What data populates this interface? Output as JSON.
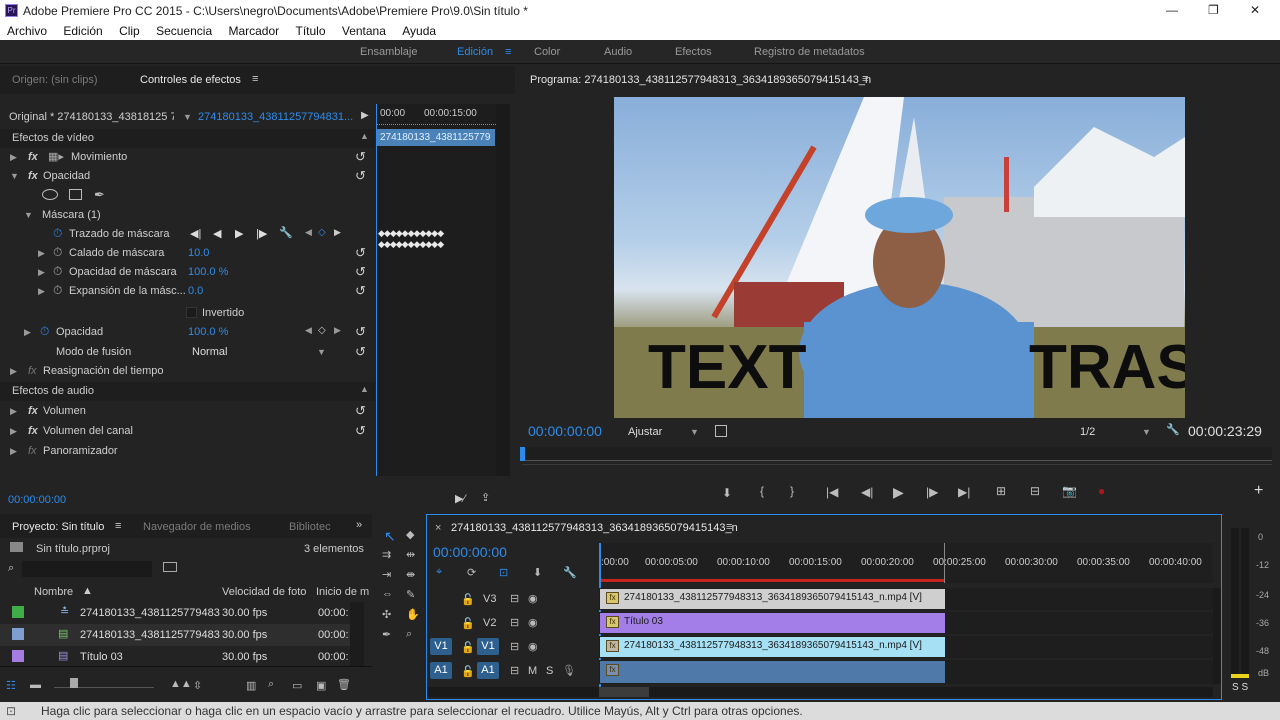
{
  "app": {
    "title": "Adobe Premiere Pro CC 2015 - C:\\Users\\negro\\Documents\\Adobe\\Premiere Pro\\9.0\\Sin título *",
    "window_controls": [
      "—",
      "❐",
      "✕"
    ]
  },
  "menu": [
    "Archivo",
    "Edición",
    "Clip",
    "Secuencia",
    "Marcador",
    "Título",
    "Ventana",
    "Ayuda"
  ],
  "workspaces": [
    "Ensamblaje",
    "Edición",
    "Color",
    "Audio",
    "Efectos",
    "Registro de metadatos"
  ],
  "source_panel": {
    "tab_origin": "Origen: (sin clips)",
    "tab_effects": "Controles de efectos",
    "master_label": "Original * 274180133_43818125 7...",
    "clip_label": "274180133_43811257794831...",
    "ruler_start": "00:00",
    "ruler_mark": "00:00:15:00",
    "mini_clip": "274180133_4381125779",
    "video_effects": "Efectos de vídeo",
    "rows": {
      "movimiento": "Movimiento",
      "opacidad": "Opacidad",
      "mascara": "Máscara (1)",
      "trazado": "Trazado de máscara",
      "calado": "Calado de máscara",
      "calado_val": "10.0",
      "op_mascara": "Opacidad de máscara",
      "op_mascara_val": "100.0 %",
      "expansion": "Expansión de la másc...",
      "expansion_val": "0.0",
      "invertido": "Invertido",
      "opacidad2": "Opacidad",
      "opacidad2_val": "100.0 %",
      "fusion": "Modo de fusión",
      "fusion_val": "Normal",
      "reasign": "Reasignación del tiempo"
    },
    "audio_effects": "Efectos de audio",
    "audio_rows": [
      "Volumen",
      "Volumen del canal",
      "Panoramizador"
    ],
    "timecode": "00:00:00:00"
  },
  "program": {
    "title": "Programa: 274180133_438112577948313_3634189365079415143_n",
    "timecode_in": "00:00:00:00",
    "fit": "Ajustar",
    "resolution": "1/2",
    "timecode_out": "00:00:23:29",
    "overlay_text_left": "TEXT",
    "overlay_text_right": "TRAS"
  },
  "project": {
    "tab_project": "Proyecto: Sin título",
    "tab_media": "Navegador de medios",
    "tab_lib": "Bibliotec",
    "file": "Sin título.prproj",
    "count": "3 elementos",
    "col_name": "Nombre",
    "col_fps": "Velocidad de foto",
    "col_start": "Inicio de m",
    "items": [
      {
        "name": "274180133_4381125779483",
        "fps": "30.00 fps",
        "start": "00:00:",
        "color": "#3fae49"
      },
      {
        "name": "274180133_4381125779483",
        "fps": "30.00 fps",
        "start": "00:00:",
        "color": "#7f9fd1"
      },
      {
        "name": "Título 03",
        "fps": "30.00 fps",
        "start": "00:00:",
        "color": "#a57ce3"
      }
    ]
  },
  "timeline": {
    "title": "274180133_438112577948313_3634189365079415143_n",
    "timecode": "00:00:00:00",
    "ruler": [
      ":00:00",
      "00:00:05:00",
      "00:00:10:00",
      "00:00:15:00",
      "00:00:20:00",
      "00:00:25:00",
      "00:00:30:00",
      "00:00:35:00",
      "00:00:40:00"
    ],
    "tracks": {
      "v3": "V3",
      "v2": "V2",
      "v1": "V1",
      "a1": "A1",
      "m": "M",
      "s": "S"
    },
    "clips": {
      "v3": "274180133_438112577948313_3634189365079415143_n.mp4 [V]",
      "v2": "Título 03",
      "v1": "274180133_438112577948313_3634189365079415143_n.mp4 [V]"
    },
    "meter_labels": [
      "0",
      "-12",
      "-24",
      "-36",
      "-48",
      "dB"
    ],
    "meter_ss": "S S"
  },
  "status": "Haga clic para seleccionar o haga clic en un espacio vacío y arrastre para seleccionar el recuadro. Utilice Mayús, Alt y Ctrl para otras opciones.",
  "colors": {
    "accent": "#2d8ceb",
    "v3_clip": "#cfcfcf",
    "v2_clip": "#a37ee8",
    "v1_clip": "#a6e0f4",
    "a1_clip": "#4f79a8"
  }
}
